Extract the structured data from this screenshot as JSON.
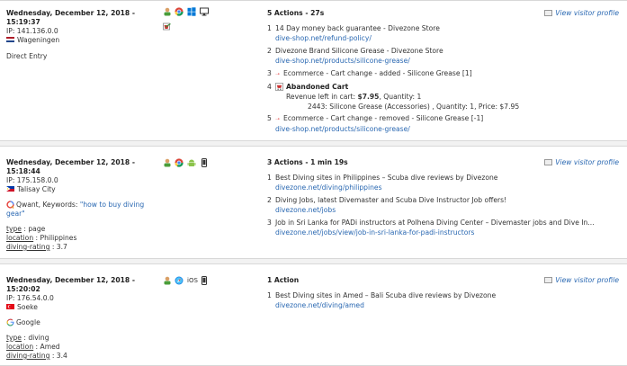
{
  "visits": [
    {
      "date": "Wednesday, December 12, 2018 -",
      "time": "15:19:37",
      "ip": "IP: 141.136.0.0",
      "city": "Wageningen",
      "referrer": "Direct Entry",
      "actions_header": "5 Actions - 27s",
      "profile_label": "View visitor profile",
      "actions": [
        {
          "num": "1",
          "title": "14 Day money back guarantee - Divezone Store",
          "url": "dive-shop.net/refund-policy/"
        },
        {
          "num": "2",
          "title": "Divezone Brand Silicone Grease - Divezone Store",
          "url": "dive-shop.net/products/silicone-grease/"
        },
        {
          "num": "3",
          "title": "Ecommerce - Cart change - added - Silicone Grease [1]"
        },
        {
          "num": "4",
          "title": "Abandoned Cart",
          "detail_prefix": "Revenue left in cart: ",
          "detail_value": "$7.95",
          "detail_suffix": ", Quantity: 1",
          "item": "2443: Silicone Grease (Accessories) , Quantity: 1, Price: $7.95"
        },
        {
          "num": "5",
          "title": "Ecommerce - Cart change - removed - Silicone Grease [-1]",
          "url": "dive-shop.net/products/silicone-grease/"
        }
      ]
    },
    {
      "date": "Wednesday, December 12, 2018 -",
      "time": "15:18:44",
      "ip": "IP: 175.158.0.0",
      "city": "Talisay City",
      "referrer_prefix": "Qwant, Keywords: ",
      "keyword": "\"how to buy diving gear\"",
      "attrs": [
        {
          "key": "type",
          "value": " : page"
        },
        {
          "key": "location",
          "value": " : Philippines"
        },
        {
          "key": "diving-rating",
          "value": " : 3.7"
        }
      ],
      "actions_header": "3 Actions - 1 min 19s",
      "profile_label": "View visitor profile",
      "actions": [
        {
          "num": "1",
          "title": "Best Diving sites in Philippines – Scuba dive reviews by Divezone",
          "url": "divezone.net/diving/philippines"
        },
        {
          "num": "2",
          "title": "Diving Jobs, latest Divemaster and Scuba Dive Instructor Job offers!",
          "url": "divezone.net/jobs"
        },
        {
          "num": "3",
          "title": "Job in Sri Lanka for PADi instructors at Polhena Diving Center – Divemaster jobs and Dive In...",
          "url": "divezone.net/jobs/view/job-in-sri-lanka-for-padi-instructors"
        }
      ]
    },
    {
      "date": "Wednesday, December 12, 2018 -",
      "time": "15:20:02",
      "ip": "IP: 176.54.0.0",
      "city": "Soeke",
      "referrer": "Google",
      "ios": "iOS",
      "attrs": [
        {
          "key": "type",
          "value": " : diving"
        },
        {
          "key": "location",
          "value": " : Amed"
        },
        {
          "key": "diving-rating",
          "value": " : 3.4"
        }
      ],
      "actions_header": "1 Action",
      "profile_label": "View visitor profile",
      "actions": [
        {
          "num": "1",
          "title": "Best Diving sites in Amed – Bali Scuba dive reviews by Divezone",
          "url": "divezone.net/diving/amed"
        }
      ]
    }
  ],
  "colors": {
    "link": "#2a68b2",
    "flag_nl": [
      "#ae1c28",
      "#ffffff",
      "#21468b"
    ],
    "flag_ph": [
      "#0038a8",
      "#ce1126",
      "#ffffff"
    ],
    "flag_tr": "#e30a17"
  },
  "icons": {
    "visitor": "person-icon",
    "chrome": "chrome-icon",
    "windows": "windows-icon",
    "desktop": "monitor-icon",
    "android": "android-icon",
    "smartphone": "smartphone-icon",
    "safari": "safari-icon",
    "goal": "goal-icon",
    "cart": "cart-icon",
    "ecommerce": "ecommerce-arrow-icon",
    "profile": "visitor-profile-icon",
    "qwant": "qwant-icon",
    "google": "google-icon"
  }
}
